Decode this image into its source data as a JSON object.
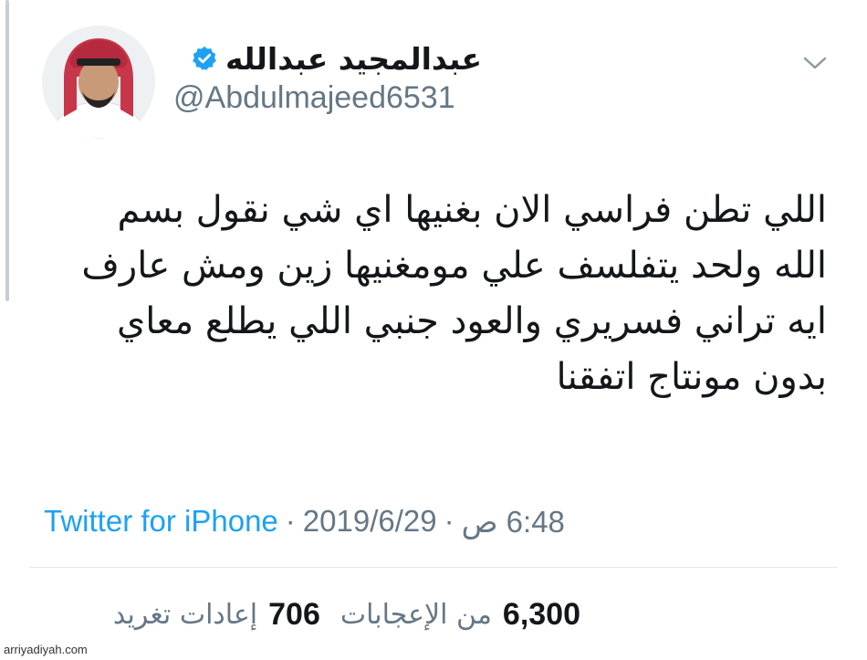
{
  "user": {
    "display_name": "عبدالمجيد عبدالله",
    "handle": "@Abdulmajeed6531",
    "verified": true
  },
  "tweet": {
    "lines": [
      "اللي تطن فراسي الان بغنيها  اي شي نقول بسم",
      "الله ولحد يتفلسف علي مومغنيها زين ومش عارف",
      "ايه تراني فسريري والعود جنبي اللي يطلع معاي",
      "بدون مونتاج اتفقنا"
    ]
  },
  "meta": {
    "source": "Twitter for iPhone",
    "separator": "·",
    "date": "2019/6/29",
    "time": "6:48 ص"
  },
  "stats": {
    "likes_count": "6,300",
    "likes_label": "من الإعجابات",
    "retweets_count": "706",
    "retweets_label": "إعادات تغريد"
  },
  "watermark": "arriyadiyah.com",
  "icons": {
    "verified": "verified-badge-icon",
    "menu": "chevron-down-icon"
  },
  "colors": {
    "accent": "#1da1f2",
    "secondary_text": "#657786",
    "primary_text": "#14171a"
  }
}
